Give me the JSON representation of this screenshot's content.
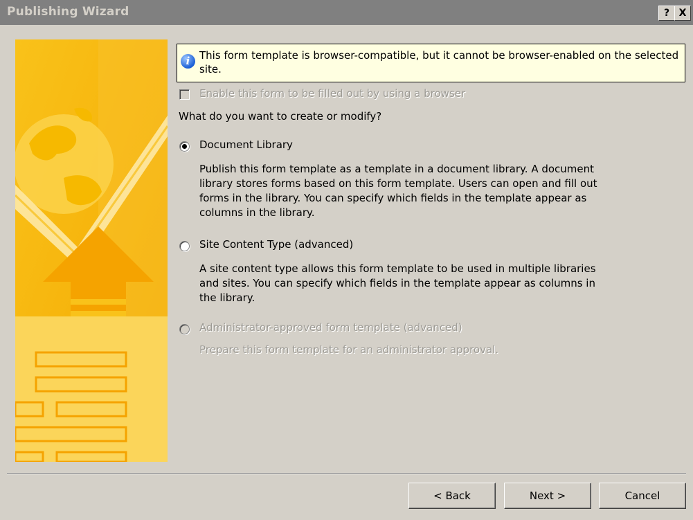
{
  "window": {
    "title": "Publishing Wizard",
    "help_label": "?",
    "close_label": "X"
  },
  "info": {
    "icon": "info-icon",
    "text": "This form template is browser-compatible, but it cannot be browser-enabled on the selected site."
  },
  "browser_checkbox": {
    "label": "Enable this form to be filled out by using a browser",
    "checked": false,
    "enabled": false
  },
  "question": "What do you want to create or modify?",
  "options": [
    {
      "label": "Document Library",
      "description": "Publish this form template as a template in a document library. A document library stores forms based on this form template. Users can open and fill out forms in the library. You can specify which fields in the template appear as columns in the library.",
      "selected": true,
      "enabled": true
    },
    {
      "label": "Site Content Type (advanced)",
      "description": "A site content type allows this form template to be used in multiple libraries and sites. You can specify which fields in the template appear as columns in the library.",
      "selected": false,
      "enabled": true
    },
    {
      "label": "Administrator-approved form template (advanced)",
      "description": "Prepare this form template for an administrator approval.",
      "selected": false,
      "enabled": false
    }
  ],
  "buttons": {
    "back": "< Back",
    "next": "Next >",
    "cancel": "Cancel"
  },
  "colors": {
    "dialog_bg": "#d4d0c8",
    "titlebar_inactive": "#808080",
    "infobar_bg": "#ffffe1",
    "banner_orange": "#f7b800",
    "disabled_text": "#9c9a94"
  }
}
